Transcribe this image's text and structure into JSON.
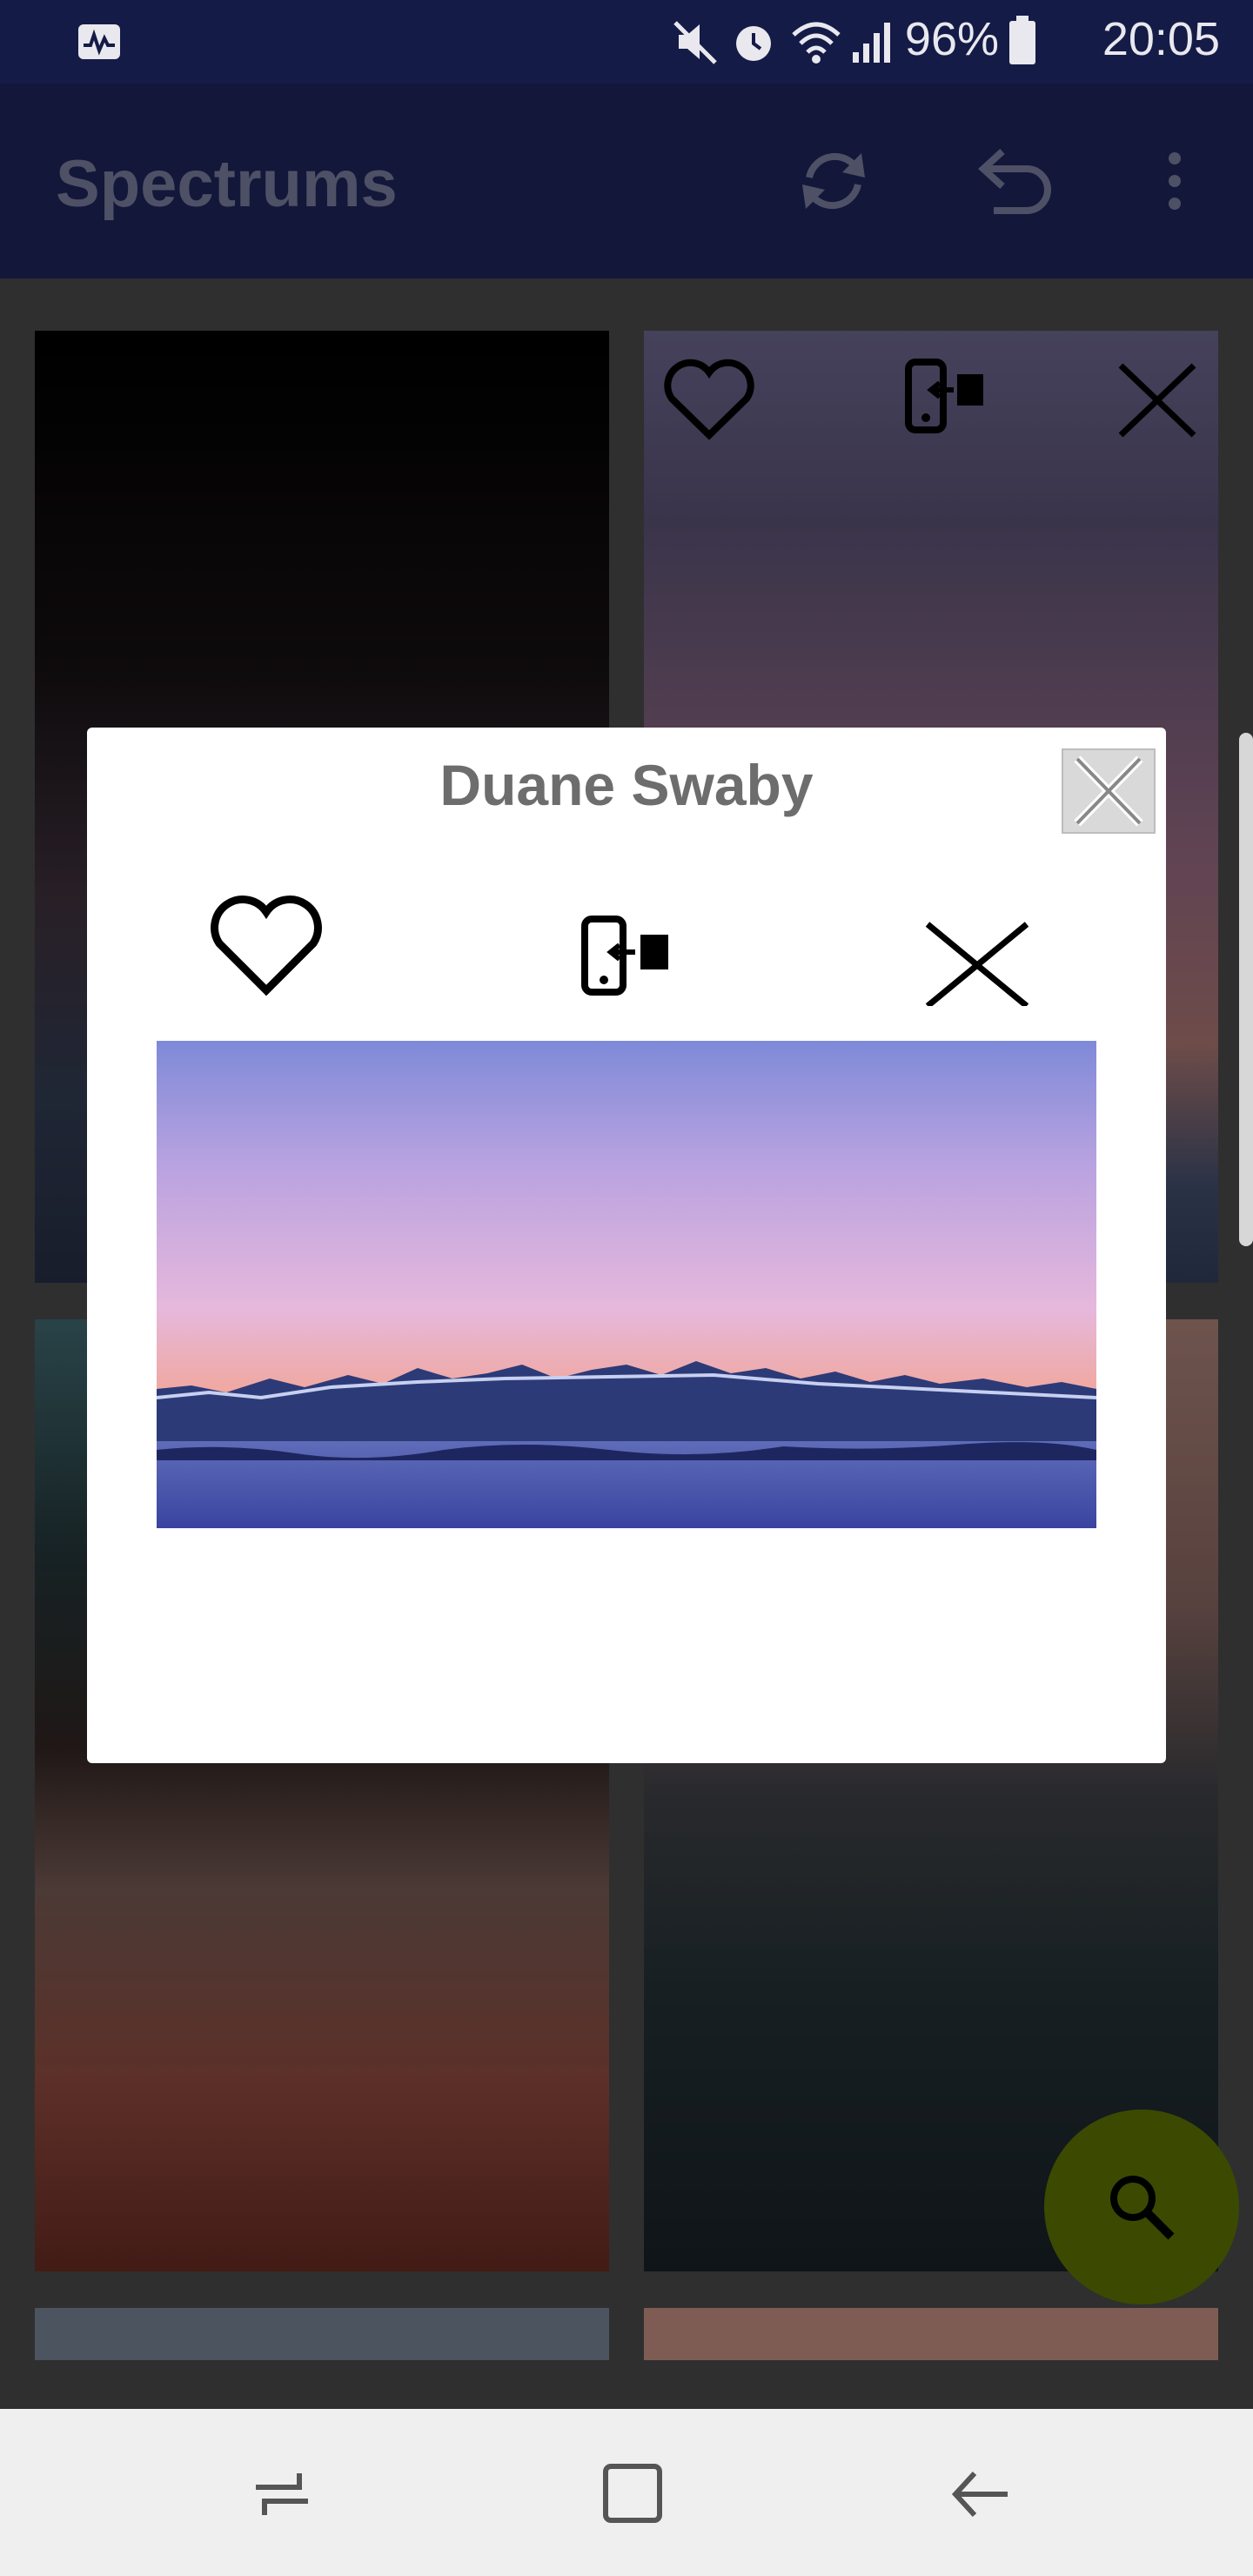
{
  "status_bar": {
    "activity_icon": "activity-icon",
    "battery_percent": "96%",
    "time": "20:05"
  },
  "app_bar": {
    "title": "Spectrums",
    "refresh_icon": "refresh-icon",
    "undo_icon": "undo-icon",
    "menu_icon": "more-vert-icon"
  },
  "dialog": {
    "title": "Duane Swaby",
    "favorite_icon": "heart-icon",
    "set_wallpaper_icon": "set-wallpaper-icon",
    "remove_icon": "close-icon",
    "close_icon": "close-box-icon"
  },
  "fab": {
    "icon": "search-icon",
    "color": "#3b4a00"
  },
  "colors": {
    "status_bar": "#151b47",
    "app_bar": "#232b6b",
    "dialog_bg": "#ffffff"
  }
}
